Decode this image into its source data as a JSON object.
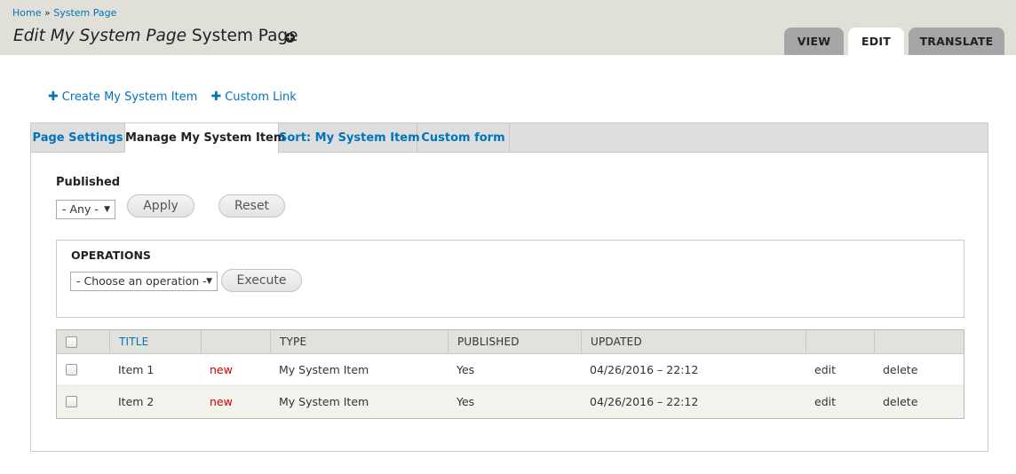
{
  "breadcrumb": {
    "home": "Home",
    "separator": "»",
    "current": "System Page"
  },
  "title": {
    "italic": "Edit My System Page",
    "plain": "System Page",
    "shortcut_icon": "add-shortcut-icon"
  },
  "primary_tabs": [
    {
      "label": "VIEW",
      "active": false
    },
    {
      "label": "EDIT",
      "active": true
    },
    {
      "label": "TRANSLATE",
      "active": false
    }
  ],
  "action_links": [
    {
      "icon": "plus-icon",
      "label": "Create My System Item"
    },
    {
      "icon": "plus-icon",
      "label": "Custom Link"
    }
  ],
  "secondary_tabs": [
    {
      "label": "Page Settings",
      "active": false
    },
    {
      "label": "Manage My System Item",
      "active": true
    },
    {
      "label": "Sort: My System Item",
      "active": false
    },
    {
      "label": "Custom form",
      "active": false
    }
  ],
  "filter": {
    "label": "Published",
    "select_value": "- Any -",
    "apply_label": "Apply",
    "reset_label": "Reset"
  },
  "operations": {
    "legend": "OPERATIONS",
    "select_value": "- Choose an operation -",
    "execute_label": "Execute"
  },
  "table": {
    "headers": [
      "",
      "TITLE",
      "",
      "TYPE",
      "PUBLISHED",
      "UPDATED",
      "",
      ""
    ],
    "rows": [
      {
        "title": "Item 1",
        "mark": "new",
        "type": "My System Item",
        "published": "Yes",
        "updated": "04/26/2016 – 22:12",
        "edit": "edit",
        "delete": "delete"
      },
      {
        "title": "Item 2",
        "mark": "new",
        "type": "My System Item",
        "published": "Yes",
        "updated": "04/26/2016 – 22:12",
        "edit": "edit",
        "delete": "delete"
      }
    ]
  },
  "colors": {
    "link": "#0074bd",
    "header_bg": "#e0e0d8",
    "tab_inactive": "#a6a6a6",
    "new_mark": "#cc0000"
  }
}
